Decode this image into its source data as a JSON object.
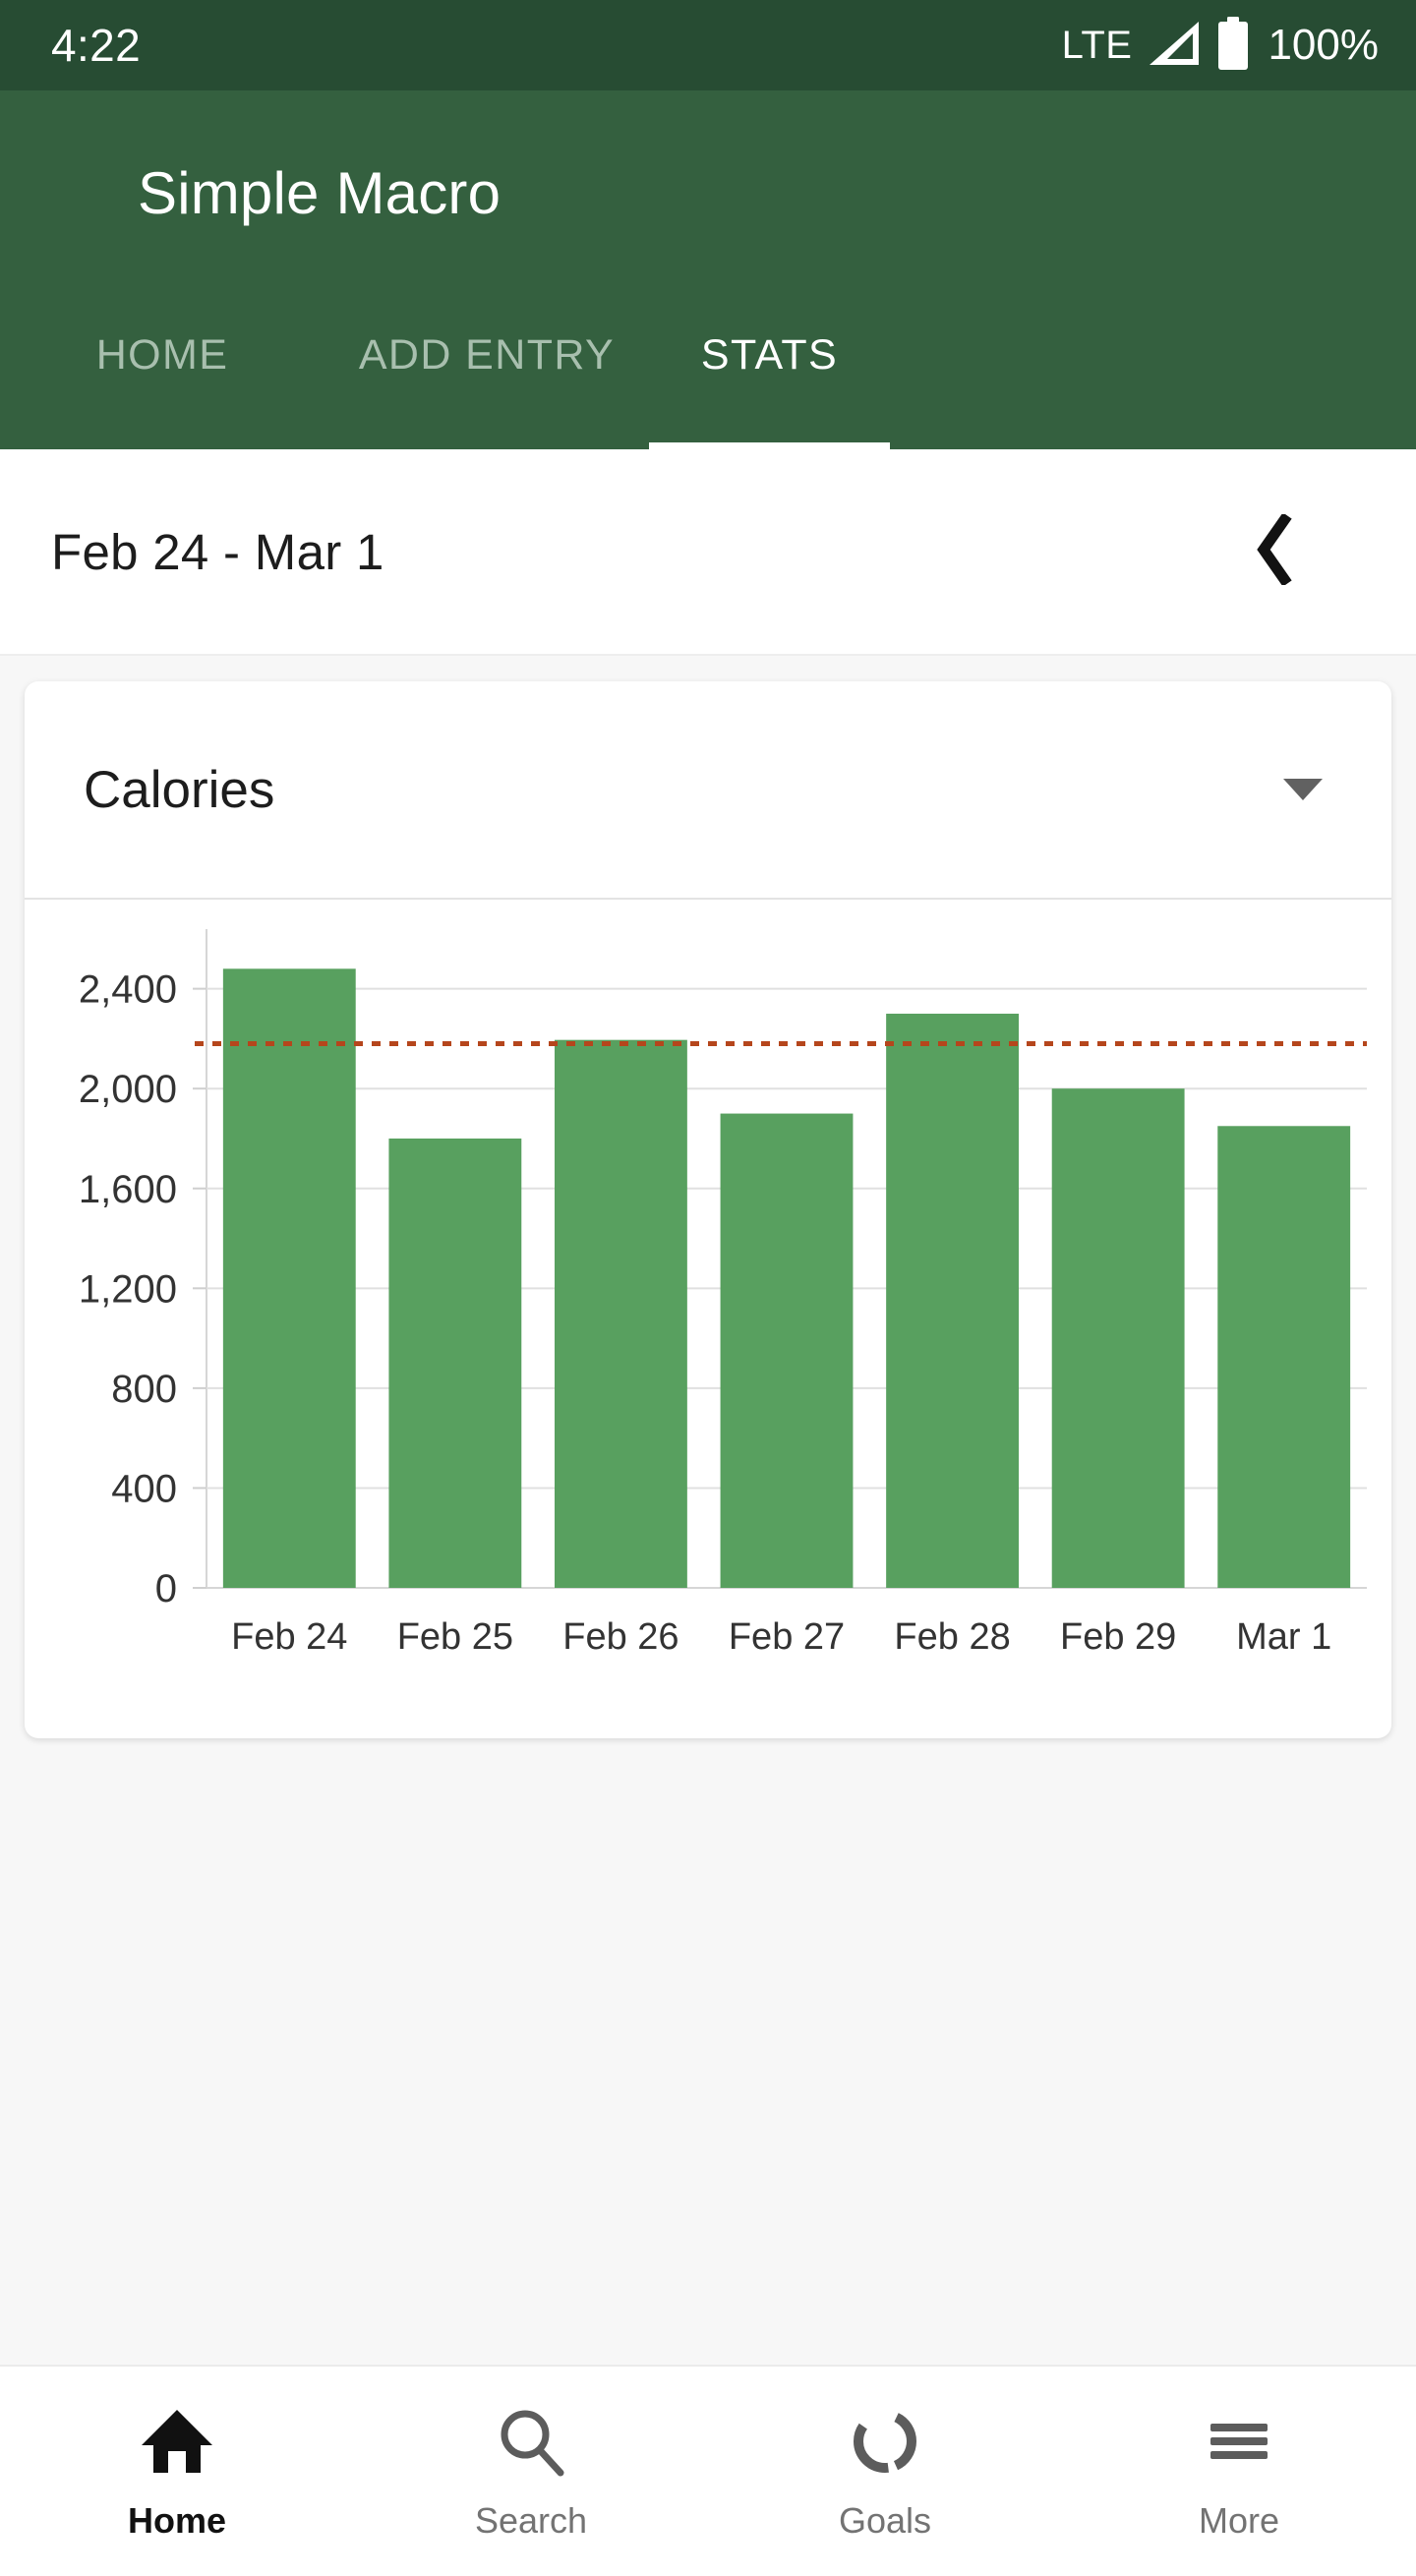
{
  "status_bar": {
    "clock": "4:22",
    "network": "LTE",
    "battery_percent": "100%",
    "signal_icon": "signal-bars-icon",
    "battery_icon": "battery-full-icon"
  },
  "app_bar": {
    "title": "Simple Macro",
    "tabs": [
      {
        "label": "HOME",
        "active": false
      },
      {
        "label": "ADD ENTRY",
        "active": false
      },
      {
        "label": "STATS",
        "active": true
      }
    ]
  },
  "date_bar": {
    "range_text": "Feb 24  -  Mar 1",
    "prev_icon": "chevron-left-icon"
  },
  "card": {
    "title": "Calories",
    "dropdown_icon": "chevron-down-icon"
  },
  "bottom_nav": {
    "items": [
      {
        "label": "Home",
        "icon": "home-icon",
        "active": true
      },
      {
        "label": "Search",
        "icon": "search-icon",
        "active": false
      },
      {
        "label": "Goals",
        "icon": "goals-ring-icon",
        "active": false
      },
      {
        "label": "More",
        "icon": "menu-hamburger-icon",
        "active": false
      }
    ]
  },
  "colors": {
    "status_bar": "#274c33",
    "app_bar": "#34603f",
    "bar_fill": "#58a05f",
    "goal_line": "#b5461c",
    "grid": "#e0e0e0",
    "page_background": "#f7f7f7",
    "card_background": "#ffffff",
    "active_nav": "#111111",
    "inactive_nav": "#737373"
  },
  "chart_data": {
    "type": "bar",
    "title": "Calories",
    "xlabel": "",
    "ylabel": "",
    "categories": [
      "Feb 24",
      "Feb 25",
      "Feb 26",
      "Feb 27",
      "Feb 28",
      "Feb 29",
      "Mar 1"
    ],
    "values": [
      2480,
      1800,
      2195,
      1900,
      2300,
      2000,
      1850
    ],
    "ylim": [
      0,
      2560
    ],
    "ytick_labels": [
      "0",
      "400",
      "800",
      "1,200",
      "1,600",
      "2,000",
      "2,400"
    ],
    "ytick_values": [
      0,
      400,
      800,
      1200,
      1600,
      2000,
      2400
    ],
    "grid": true,
    "legend": false,
    "annotations": [
      {
        "type": "hline",
        "label": "goal",
        "value": 2180,
        "style": "dotted",
        "color": "#b5461c"
      }
    ]
  }
}
